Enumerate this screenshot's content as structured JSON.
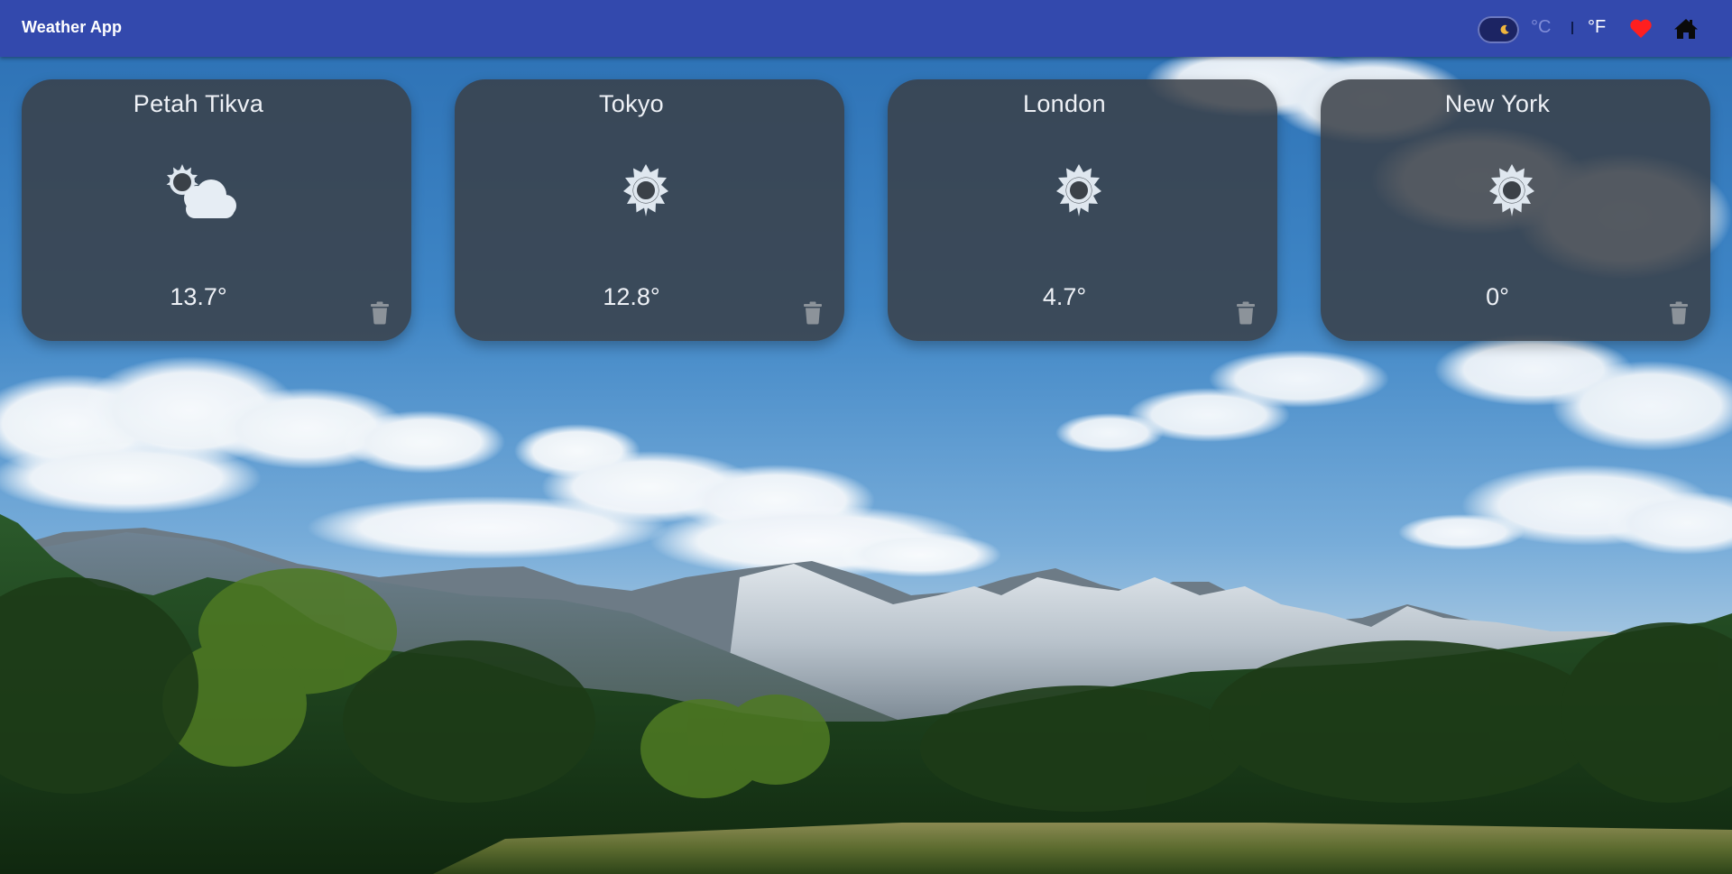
{
  "header": {
    "title": "Weather App",
    "theme_toggle_icon": "moon-icon",
    "unit_celsius": "°C",
    "unit_fahrenheit": "°F",
    "active_unit": "°F",
    "favorites_icon": "heart-icon",
    "home_icon": "home-icon",
    "bar_color": "#3349ad",
    "heart_color": "#ff1f1f"
  },
  "cards": [
    {
      "city": "Petah Tikva",
      "temperature": "13.7°",
      "condition_icon": "partly-cloudy-icon"
    },
    {
      "city": "Tokyo",
      "temperature": "12.8°",
      "condition_icon": "sun-icon"
    },
    {
      "city": "London",
      "temperature": "4.7°",
      "condition_icon": "sun-icon"
    },
    {
      "city": "New York",
      "temperature": "0°",
      "condition_icon": "sun-icon"
    }
  ],
  "card_actions": {
    "delete_icon": "trash-icon"
  }
}
